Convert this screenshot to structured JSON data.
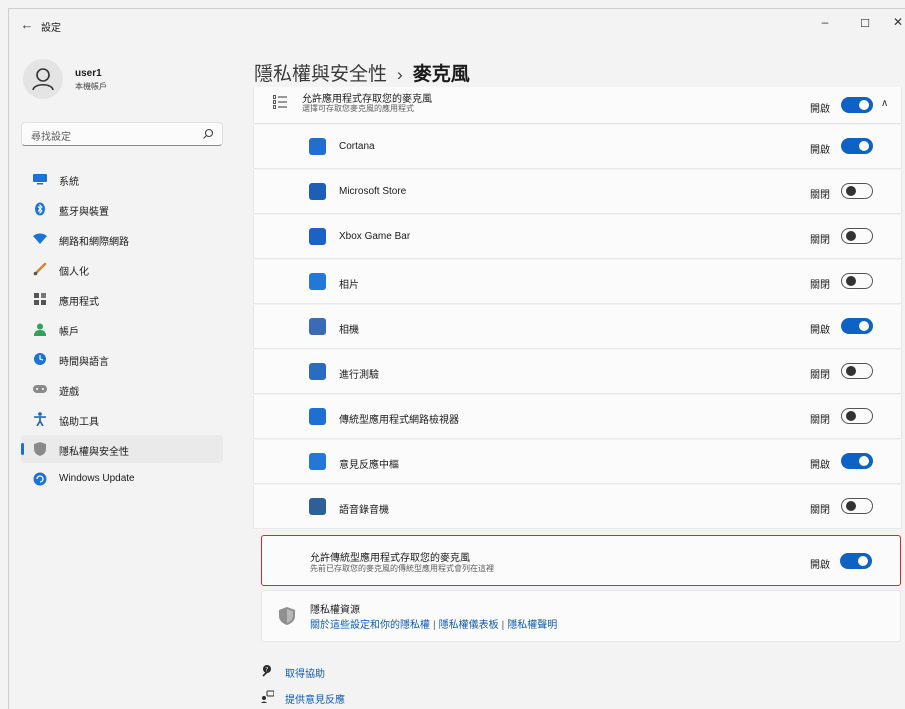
{
  "window": {
    "title": "設定",
    "back_glyph": "←",
    "minimize_glyph": "–",
    "maximize_glyph": "☐",
    "close_glyph": "✕"
  },
  "profile": {
    "name": "user1",
    "account_type": "本機帳戶"
  },
  "search": {
    "placeholder": "尋找設定"
  },
  "sidebar": {
    "items": [
      {
        "label": "系統",
        "icon": "monitor-icon"
      },
      {
        "label": "藍牙與裝置",
        "icon": "bluetooth-icon"
      },
      {
        "label": "網路和網際網路",
        "icon": "wifi-icon"
      },
      {
        "label": "個人化",
        "icon": "brush-icon"
      },
      {
        "label": "應用程式",
        "icon": "apps-icon"
      },
      {
        "label": "帳戶",
        "icon": "person-icon"
      },
      {
        "label": "時間與語言",
        "icon": "globe-clock-icon"
      },
      {
        "label": "遊戲",
        "icon": "gamepad-icon"
      },
      {
        "label": "協助工具",
        "icon": "accessibility-icon"
      },
      {
        "label": "隱私權與安全性",
        "icon": "shield-icon",
        "active": true
      },
      {
        "label": "Windows Update",
        "icon": "update-icon"
      }
    ]
  },
  "breadcrumb": {
    "parent": "隱私權與安全性",
    "separator": "›",
    "current": "麥克風"
  },
  "apps_access": {
    "title": "允許應用程式存取您的麥克風",
    "subtitle": "選擇可存取您麥克風的應用程式",
    "state": "開啟",
    "on": true,
    "chevron": "∧"
  },
  "apps": [
    {
      "name": "Cortana",
      "state": "開啟",
      "on": true,
      "color": "#1f6fd1",
      "icon": "cortana-icon"
    },
    {
      "name": "Microsoft Store",
      "state": "關閉",
      "on": false,
      "color": "#1d5fb8",
      "icon": "store-icon"
    },
    {
      "name": "Xbox Game Bar",
      "state": "關閉",
      "on": false,
      "color": "#1b63c2",
      "icon": "xbox-game-bar-icon"
    },
    {
      "name": "相片",
      "state": "關閉",
      "on": false,
      "color": "#2377d8",
      "icon": "photos-icon"
    },
    {
      "name": "相機",
      "state": "開啟",
      "on": true,
      "color": "#3a6bb5",
      "icon": "camera-icon"
    },
    {
      "name": "進行測驗",
      "state": "關閉",
      "on": false,
      "color": "#2a6cc4",
      "icon": "take-a-test-icon"
    },
    {
      "name": "傳統型應用程式網路檢視器",
      "state": "關閉",
      "on": false,
      "color": "#1d6fd0",
      "icon": "web-viewer-icon"
    },
    {
      "name": "意見反應中樞",
      "state": "開啟",
      "on": true,
      "color": "#2477d6",
      "icon": "feedback-hub-icon"
    },
    {
      "name": "語音錄音機",
      "state": "關閉",
      "on": false,
      "color": "#2f5f99",
      "icon": "voice-recorder-icon"
    }
  ],
  "legacy": {
    "title": "允許傳統型應用程式存取您的麥克風",
    "subtitle": "先前已存取您的麥克風的傳統型應用程式會列在這裡",
    "state": "開啟",
    "on": true
  },
  "privacy_resources": {
    "title": "隱私權資源",
    "links": [
      "關於這些設定和你的隱私權",
      "隱私權儀表板",
      "隱私權聲明"
    ],
    "separator": "|"
  },
  "footer": {
    "get_help": "取得協助",
    "give_feedback": "提供意見反應"
  },
  "colors": {
    "accent": "#0f62c5",
    "link": "#0f5ab8",
    "highlight_border": "#d9272e"
  }
}
